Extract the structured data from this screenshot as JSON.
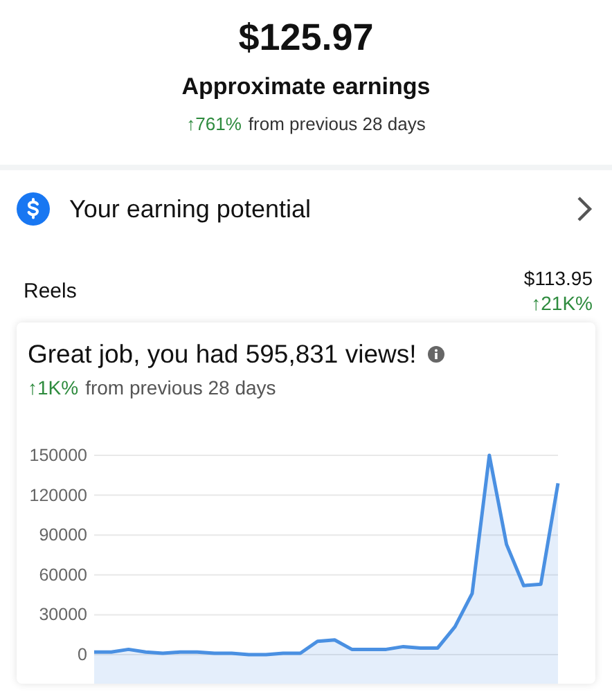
{
  "summary": {
    "amount": "$125.97",
    "label": "Approximate earnings",
    "change": "↑761%",
    "change_label": "from previous 28 days"
  },
  "potential_row": {
    "label": "Your earning potential"
  },
  "breakdown": [
    {
      "label": "Reels",
      "amount": "$113.95",
      "change": "↑21K%"
    }
  ],
  "views_card": {
    "title": "Great job, you had 595,831 views!",
    "change": "↑1K%",
    "change_label": "from previous 28 days",
    "chart_data": {
      "type": "area",
      "grid": true,
      "ylim": [
        0,
        150000
      ],
      "yticks": [
        0,
        30000,
        60000,
        90000,
        120000,
        150000
      ],
      "series": [
        {
          "color": "#4a90e2",
          "values": [
            2000,
            2000,
            4000,
            2000,
            1000,
            2000,
            2000,
            1000,
            1000,
            0,
            0,
            1000,
            1000,
            10000,
            11000,
            4000,
            4000,
            4000,
            6000,
            5000,
            5000,
            21000,
            46000,
            150000,
            83000,
            52000,
            53000,
            129000
          ]
        }
      ]
    }
  }
}
